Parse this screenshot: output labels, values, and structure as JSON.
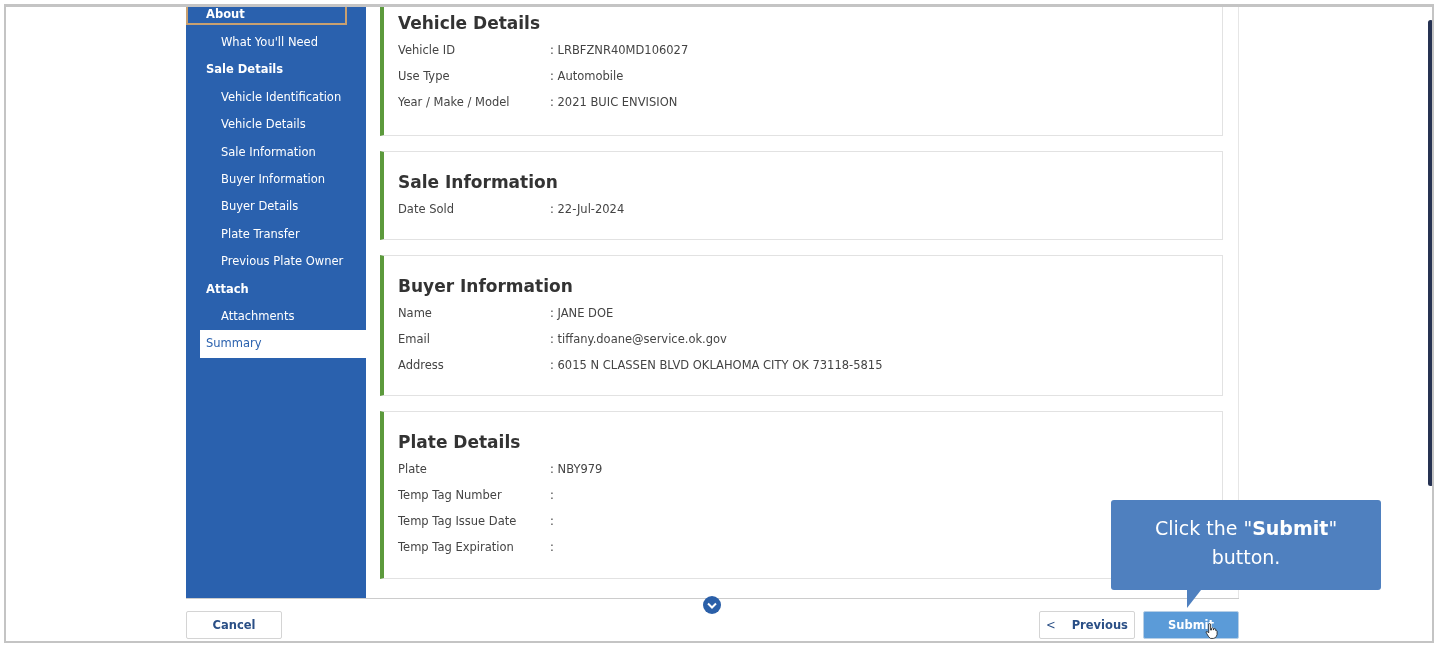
{
  "sidebar": {
    "items": [
      {
        "label": "About",
        "kind": "heading",
        "selected": false,
        "focused": true,
        "children": [
          {
            "label": "What You'll Need",
            "selected": false
          }
        ]
      },
      {
        "label": "Sale Details",
        "kind": "heading",
        "selected": false,
        "focused": false,
        "children": [
          {
            "label": "Vehicle Identification",
            "selected": false
          },
          {
            "label": "Vehicle Details",
            "selected": false
          },
          {
            "label": "Sale Information",
            "selected": false
          },
          {
            "label": "Buyer Information",
            "selected": false
          },
          {
            "label": "Buyer Details",
            "selected": false
          },
          {
            "label": "Plate Transfer",
            "selected": false
          },
          {
            "label": "Previous Plate Owner",
            "selected": false
          }
        ]
      },
      {
        "label": "Attach",
        "kind": "heading",
        "selected": false,
        "focused": false,
        "children": [
          {
            "label": "Attachments",
            "selected": false
          }
        ]
      },
      {
        "label": "Summary",
        "kind": "page",
        "selected": true,
        "focused": false
      }
    ]
  },
  "sections": [
    {
      "title": "Vehicle Details",
      "fields": [
        {
          "label": "Vehicle ID",
          "value": ": LRBFZNR40MD106027"
        },
        {
          "label": "Use Type",
          "value": ": Automobile"
        },
        {
          "label": "Year / Make / Model",
          "value": ": 2021 BUIC ENVISION"
        }
      ]
    },
    {
      "title": "Sale Information",
      "fields": [
        {
          "label": "Date Sold",
          "value": ": 22-Jul-2024"
        }
      ]
    },
    {
      "title": "Buyer Information",
      "fields": [
        {
          "label": "Name",
          "value": ": JANE DOE"
        },
        {
          "label": "Email",
          "value": ": tiffany.doane@service.ok.gov"
        },
        {
          "label": "Address",
          "value": ": 6015 N CLASSEN BLVD OKLAHOMA CITY OK 73118-5815"
        }
      ]
    },
    {
      "title": "Plate Details",
      "fields": [
        {
          "label": "Plate",
          "value": ": NBY979"
        },
        {
          "label": "Temp Tag Number",
          "value": ":"
        },
        {
          "label": "Temp Tag Issue Date",
          "value": ":"
        },
        {
          "label": "Temp Tag Expiration",
          "value": ":"
        }
      ]
    }
  ],
  "buttons": {
    "cancel": "Cancel",
    "previous_icon": "<",
    "previous": "Previous",
    "submit": "Submit"
  },
  "tooltip": {
    "text": "Click the \"**Submit**\" button."
  }
}
